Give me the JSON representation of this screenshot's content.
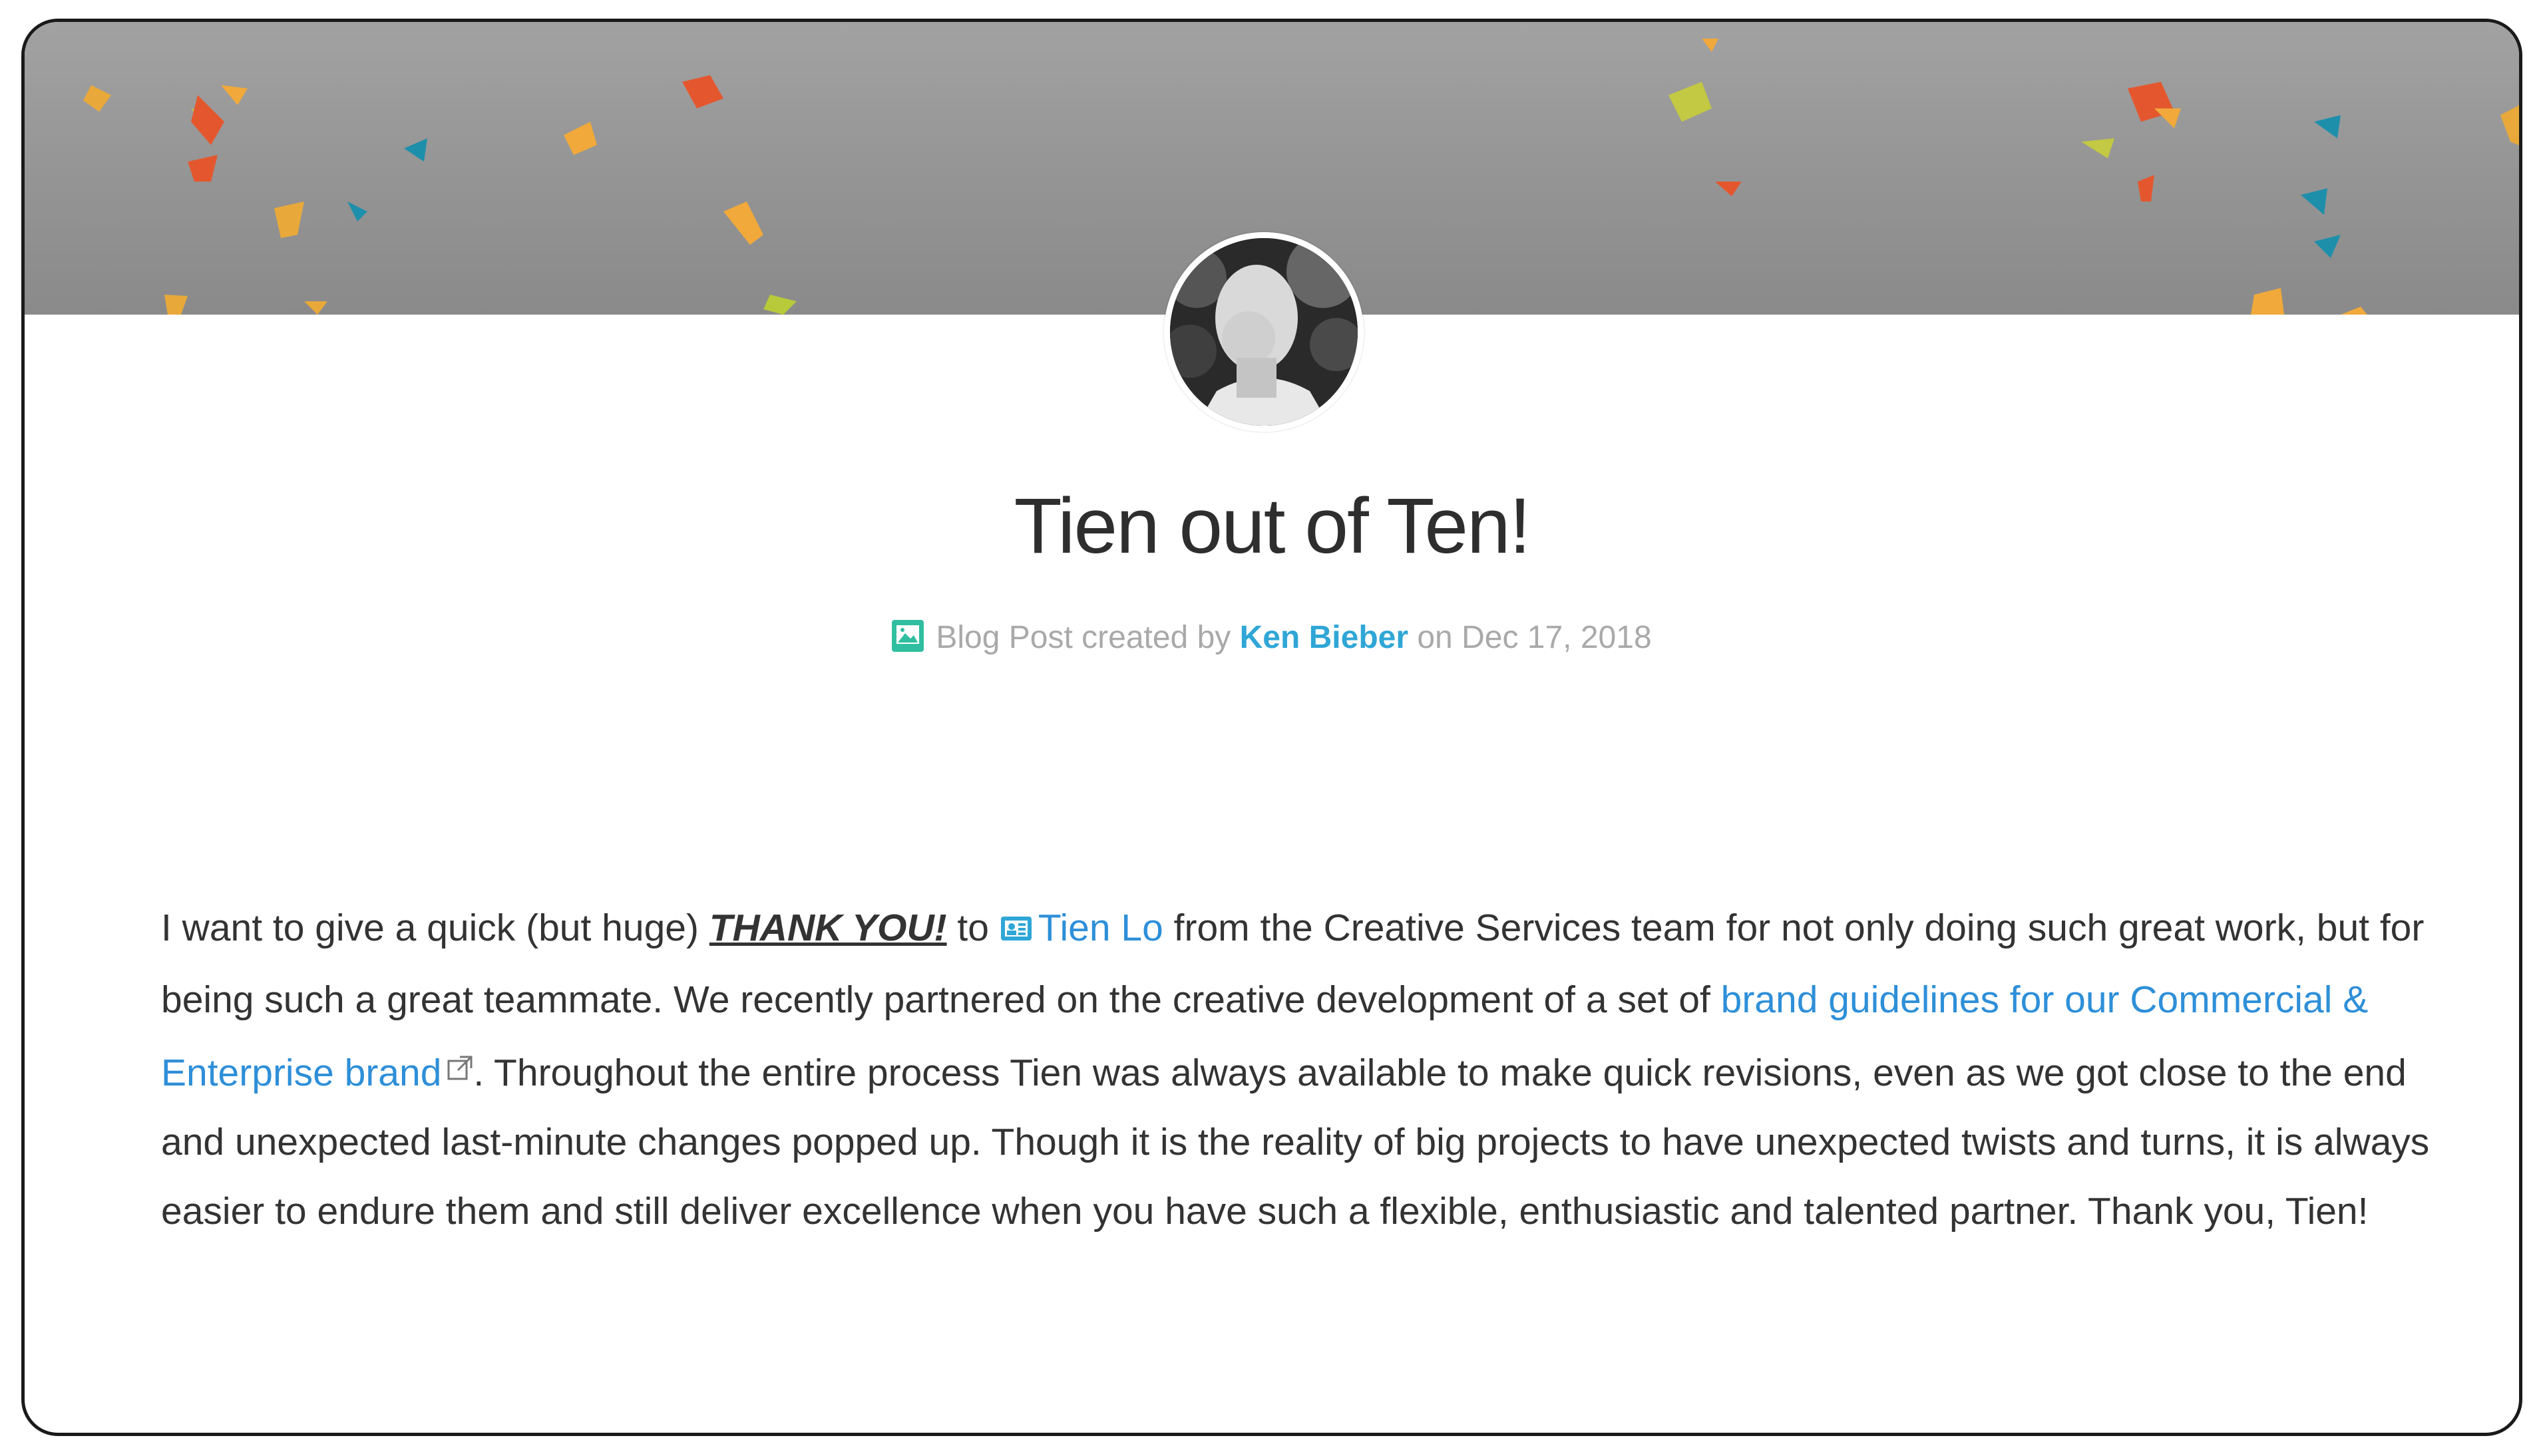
{
  "post": {
    "title": "Tien out of Ten!",
    "meta_prefix": "Blog Post created by",
    "author": "Ken Bieber",
    "meta_on": "on",
    "date": "Dec 17, 2018",
    "type_icon": "blog-post-icon"
  },
  "body": {
    "p1_start": "I want to give a quick (but huge) ",
    "thanks": "THANK YOU!",
    "p1_to": " to ",
    "mention": "Tien Lo",
    "p1_mid": " from the Creative Services team for not only doing such great work, but for being such a great teammate. We recently partnered on the creative development of a set of ",
    "link": "brand guidelines for our Commercial & Enterprise brand",
    "p1_end": ". Throughout the entire process Tien was always available to make quick revisions, even as we got close to the end and unexpected last-minute changes popped up. Though it is the reality of big projects to have unexpected twists and turns, it is always easier to endure them and still deliver excellence when you have such a flexible, enthusiastic and talented partner. Thank you, Tien!"
  },
  "colors": {
    "link": "#2e8fd8",
    "author": "#2fa6d6",
    "meta": "#a9a9a9",
    "banner": "#999999",
    "icon_teal": "#2fbfa0"
  }
}
